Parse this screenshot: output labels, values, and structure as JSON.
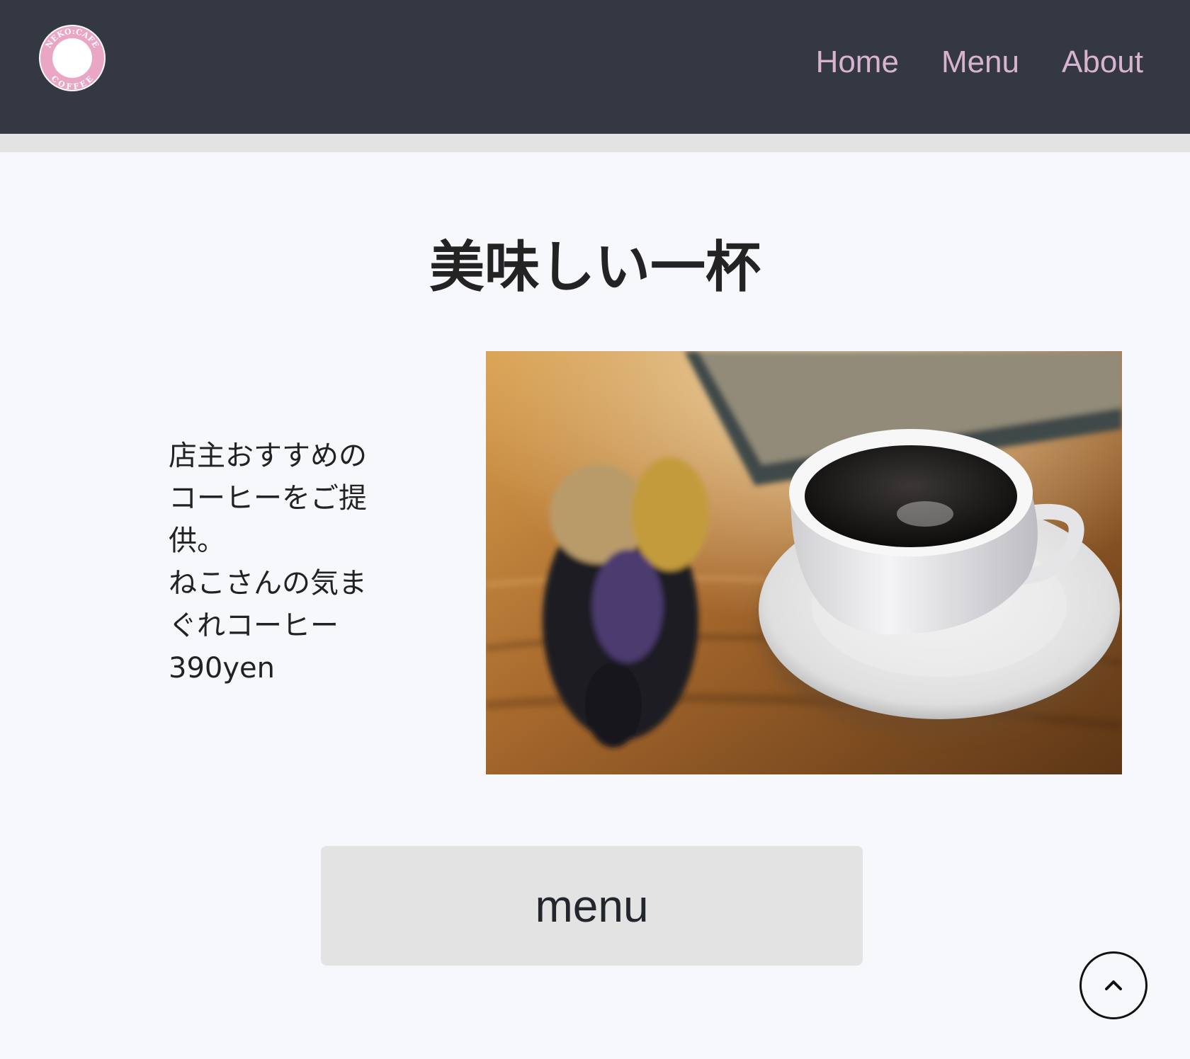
{
  "header": {
    "logo_alt": "NEKO:CAFE COFFEE",
    "logo_text_top": "NEKO:CAFE",
    "logo_text_bottom": "COFFEE",
    "nav": [
      {
        "label": "Home"
      },
      {
        "label": "Menu"
      },
      {
        "label": "About"
      }
    ]
  },
  "main": {
    "title": "美味しい一杯",
    "description_lines": [
      "店主おすすめの",
      "コーヒーをご提",
      "供。",
      "ねこさんの気ま",
      "ぐれコーヒー",
      "390yen"
    ],
    "photo_icon": "coffee-cup-photo",
    "menu_button": "menu"
  },
  "scroll_top": {
    "icon": "chevron-up-icon"
  },
  "colors": {
    "header_bg": "#343842",
    "nav_link": "#d7b3cf",
    "page_bg": "#f6f8fc",
    "button_bg": "#e3e3e3",
    "logo_pink": "#e9a6c5"
  }
}
